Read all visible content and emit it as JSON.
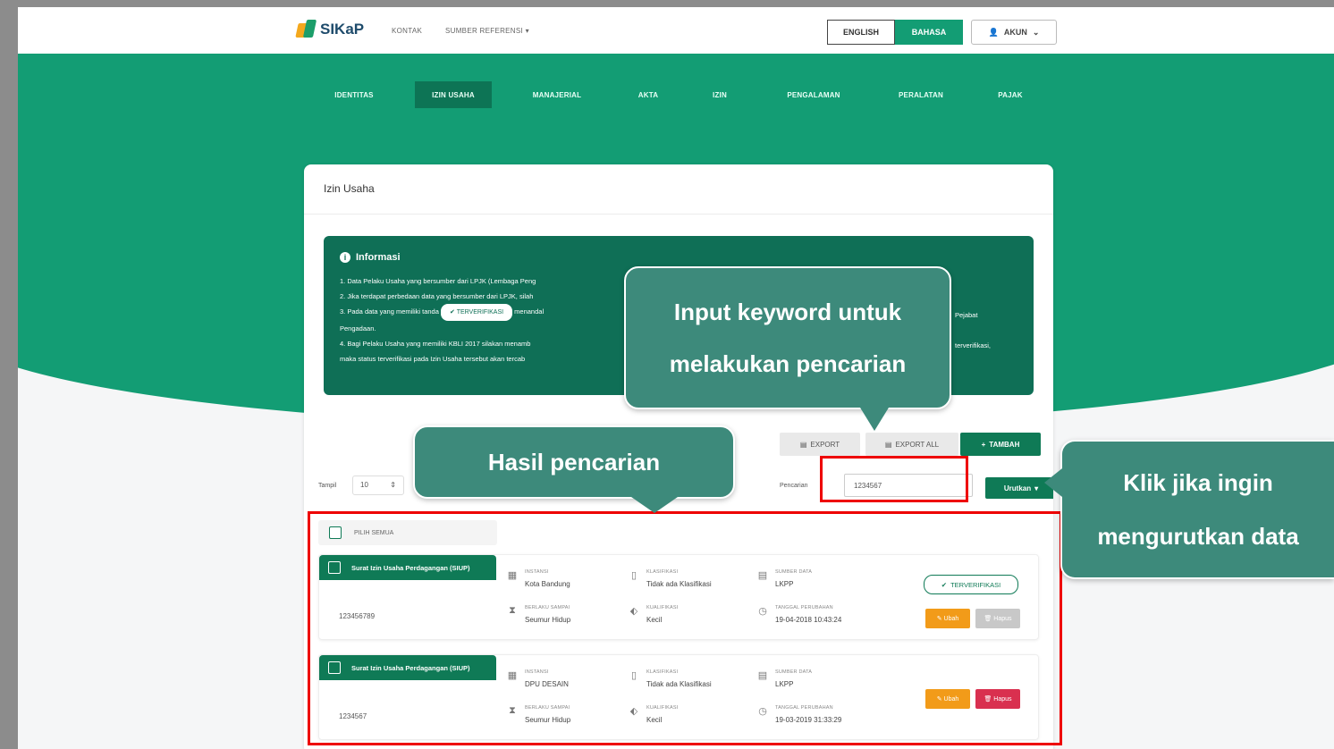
{
  "header": {
    "brand": "SIKaP",
    "nav": [
      "KONTAK",
      "SUMBER REFERENSI"
    ],
    "lang_english": "ENGLISH",
    "lang_bahasa": "BAHASA",
    "account": "AKUN"
  },
  "tabs": [
    "IDENTITAS",
    "IZIN USAHA",
    "MANAJERIAL",
    "AKTA",
    "IZIN",
    "PENGALAMAN",
    "PERALATAN",
    "PAJAK"
  ],
  "active_tab": "IZIN USAHA",
  "card": {
    "title": "Izin Usaha",
    "info_title": "Informasi",
    "info_lines": [
      "1. Data Pelaku Usaha yang bersumber dari LPJK (Lembaga Peng",
      "2. Jika terdapat perbedaan data yang bersumber dari LPJK, silah",
      "3. Pada data yang memiliki tanda",
      "Pengadaan.",
      "4. Bagi Pelaku Usaha yang memiliki KBLI 2017 silakan menamb",
      "maka status terverifikasi pada Izin Usaha tersebut akan tercab"
    ],
    "info_line3_tail": "menandal",
    "info_badge": "TERVERIFIKASI",
    "info_right_1": "Pejabat",
    "info_right_2": "terverifikasi,"
  },
  "toolbar": {
    "export": "EXPORT",
    "export_all": "EXPORT ALL",
    "tambah": "TAMBAH",
    "tampil_label": "Tampil",
    "tampil_value": "10",
    "pencarian_label": "Pencarian",
    "search_value": "1234567",
    "urutkan": "Urutkan"
  },
  "select_all": "PILIH SEMUA",
  "items": [
    {
      "title": "Surat Izin Usaha Perdagangan (SIUP)",
      "code": "123456789",
      "instansi_label": "INSTANSI",
      "instansi": "Kota Bandung",
      "klasifikasi_label": "KLASIFIKASI",
      "klasifikasi": "Tidak ada Klasifikasi",
      "sumber_label": "SUMBER DATA",
      "sumber": "LKPP",
      "berlaku_label": "BERLAKU SAMPAI",
      "berlaku": "Seumur Hidup",
      "kualifikasi_label": "KUALIFIKASI",
      "kualifikasi": "Kecil",
      "tanggal_label": "TANGGAL PERUBAHAN",
      "tanggal": "19-04-2018 10:43:24",
      "verified": "TERVERIFIKASI",
      "ubah": "Ubah",
      "hapus": "Hapus"
    },
    {
      "title": "Surat Izin Usaha Perdagangan (SIUP)",
      "code": "1234567",
      "instansi_label": "INSTANSI",
      "instansi": "DPU DESAIN",
      "klasifikasi_label": "KLASIFIKASI",
      "klasifikasi": "Tidak ada Klasifikasi",
      "sumber_label": "SUMBER DATA",
      "sumber": "LKPP",
      "berlaku_label": "BERLAKU SAMPAI",
      "berlaku": "Seumur Hidup",
      "kualifikasi_label": "KUALIFIKASI",
      "kualifikasi": "Kecil",
      "tanggal_label": "TANGGAL PERUBAHAN",
      "tanggal": "19-03-2019 31:33:29",
      "ubah": "Ubah",
      "hapus": "Hapus"
    }
  ],
  "annotations": {
    "search_callout": "Input keyword untuk\nmelakukan pencarian",
    "result_callout": "Hasil pencarian",
    "sort_callout": "Klik jika ingin\nmengurutkan data"
  },
  "colors": {
    "brand_green": "#139d74",
    "dark_green": "#0f7a56",
    "callout": "#3d8a7b",
    "highlight": "#ee0000",
    "orange": "#f29b19",
    "red": "#d9304f"
  }
}
